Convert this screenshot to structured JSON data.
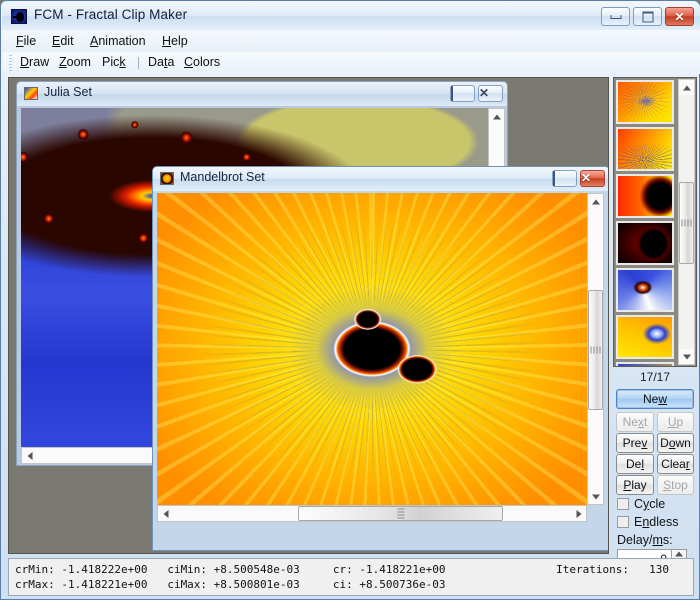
{
  "window": {
    "title": "FCM - Fractal Clip Maker",
    "icon": "fractal-app-icon",
    "buttons": {
      "minimize": "minimize-icon",
      "maximize": "maximize-icon",
      "close": "✕"
    }
  },
  "menubar": {
    "items": [
      {
        "label": "File",
        "mnemonic": "F"
      },
      {
        "label": "Edit",
        "mnemonic": "E"
      },
      {
        "label": "Animation",
        "mnemonic": "A"
      },
      {
        "label": "Help",
        "mnemonic": "H"
      }
    ]
  },
  "toolbar": {
    "items": [
      {
        "label": "Draw",
        "mnemonic": "D"
      },
      {
        "label": "Zoom",
        "mnemonic": "Z"
      },
      {
        "label": "Pick",
        "mnemonic": "k"
      },
      {
        "label": "Data",
        "mnemonic": "t"
      },
      {
        "label": "Colors",
        "mnemonic": "C"
      }
    ],
    "separator_after": 2
  },
  "child_windows": [
    {
      "title": "Julia Set",
      "icon": "julia-window-icon",
      "active": false,
      "buttons": [
        "minimize-icon",
        "close-icon"
      ]
    },
    {
      "title": "Mandelbrot Set",
      "icon": "mandelbrot-window-icon",
      "active": true,
      "buttons": [
        "minimize-icon",
        "close-icon"
      ]
    }
  ],
  "right_panel": {
    "counter": "17/17",
    "thumbnails": [
      {
        "name": "thumbnail-1"
      },
      {
        "name": "thumbnail-2"
      },
      {
        "name": "thumbnail-3"
      },
      {
        "name": "thumbnail-4"
      },
      {
        "name": "thumbnail-5"
      },
      {
        "name": "thumbnail-6"
      },
      {
        "name": "thumbnail-7"
      }
    ],
    "buttons": {
      "new": {
        "label": "New",
        "mnemonic": "w",
        "enabled": true,
        "primary": true
      },
      "next": {
        "label": "Next",
        "mnemonic": "x",
        "enabled": false
      },
      "up": {
        "label": "Up",
        "mnemonic": "U",
        "enabled": false
      },
      "prev": {
        "label": "Prev",
        "mnemonic": "v",
        "enabled": true
      },
      "down": {
        "label": "Down",
        "mnemonic": "o",
        "enabled": true
      },
      "del": {
        "label": "Del",
        "mnemonic": "l",
        "enabled": true
      },
      "clear": {
        "label": "Clear",
        "mnemonic": "r",
        "enabled": true
      },
      "play": {
        "label": "Play",
        "mnemonic": "P",
        "enabled": true
      },
      "stop": {
        "label": "Stop",
        "mnemonic": "S",
        "enabled": false
      }
    },
    "checkboxes": [
      {
        "label": "Cycle",
        "mnemonic": "y",
        "checked": false
      },
      {
        "label": "Endless",
        "mnemonic": "n",
        "checked": false
      }
    ],
    "delay": {
      "label": "Delay/ms:",
      "mnemonic": "m",
      "value": "0"
    }
  },
  "statusbar": {
    "line1": "crMin: -1.418222e+00   ciMin: +8.500548e-03     cr: -1.418221e+00",
    "line2": "crMax: -1.418221e+00   ciMax: +8.500801e-03     ci: +8.500736e-03",
    "fields": {
      "crMin": "-1.418222e+00",
      "crMax": "-1.418221e+00",
      "ciMin": "+8.500548e-03",
      "ciMax": "+8.500801e-03",
      "cr": "-1.418221e+00",
      "ci": "+8.500736e-03"
    },
    "iterations_label": "Iterations:",
    "iterations_value": "130"
  },
  "colors": {
    "title_bar": "#dfeaf7",
    "close_red": "#c23c22",
    "mdi_background": "#7a7a72",
    "accent_blue": "#4d83c0",
    "fractal_orange": "#ff8c00",
    "fractal_yellow": "#ffe800",
    "fractal_blue": "#2b3fd8"
  }
}
